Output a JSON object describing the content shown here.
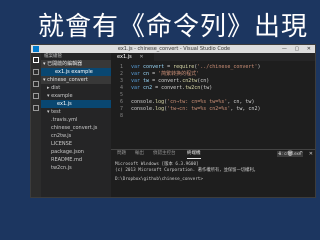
{
  "slide": {
    "title": "就會有《命令列》出現"
  },
  "window": {
    "title": "ex1.js - chinese_convert - Visual Studio Code",
    "controls": "— ▢ ✕"
  },
  "sidebar": {
    "header": "檔案總管",
    "rows": [
      {
        "label": "▾ 已開啟的編輯器",
        "indent": 2,
        "kind": "section"
      },
      {
        "label": "ex1.js example",
        "indent": 14,
        "kind": "selected"
      },
      {
        "label": "▾ chinese_convert",
        "indent": 2,
        "kind": "section"
      },
      {
        "label": "▸ dist",
        "indent": 6,
        "kind": "item"
      },
      {
        "label": "▾ example",
        "indent": 6,
        "kind": "item"
      },
      {
        "label": "ex1.js",
        "indent": 16,
        "kind": "selected"
      },
      {
        "label": "▾ test",
        "indent": 6,
        "kind": "item"
      },
      {
        "label": ".travis.yml",
        "indent": 10,
        "kind": "item"
      },
      {
        "label": "chinese_convert.js",
        "indent": 10,
        "kind": "item"
      },
      {
        "label": "cn2tw.js",
        "indent": 10,
        "kind": "item"
      },
      {
        "label": "LICENSE",
        "indent": 10,
        "kind": "item"
      },
      {
        "label": "package.json",
        "indent": 10,
        "kind": "item"
      },
      {
        "label": "README.md",
        "indent": 10,
        "kind": "item"
      },
      {
        "label": "tw2cn.js",
        "indent": 10,
        "kind": "item"
      }
    ]
  },
  "editor": {
    "tab_label": "ex1.js",
    "tab_close": "✕",
    "lines": [
      {
        "n": "1",
        "t": [
          [
            "kw",
            "var "
          ],
          [
            "var",
            "convert"
          ],
          [
            "txt",
            " = "
          ],
          [
            "fn",
            "require"
          ],
          [
            "txt",
            "("
          ],
          [
            "str",
            "'../chinese_convert'"
          ],
          [
            "txt",
            ")"
          ]
        ]
      },
      {
        "n": "2",
        "t": [
          [
            "kw",
            "var "
          ],
          [
            "var",
            "cn"
          ],
          [
            "txt",
            " = "
          ],
          [
            "str",
            "'简繁转换的程式'"
          ]
        ]
      },
      {
        "n": "3",
        "t": [
          [
            "kw",
            "var "
          ],
          [
            "var",
            "tw"
          ],
          [
            "txt",
            " = convert."
          ],
          [
            "fn",
            "cn2tw"
          ],
          [
            "txt",
            "(cn)"
          ]
        ]
      },
      {
        "n": "4",
        "t": [
          [
            "kw",
            "var "
          ],
          [
            "var",
            "cn2"
          ],
          [
            "txt",
            " = convert."
          ],
          [
            "fn",
            "tw2cn"
          ],
          [
            "txt",
            "(tw)"
          ]
        ]
      },
      {
        "n": "5",
        "t": []
      },
      {
        "n": "6",
        "t": [
          [
            "txt",
            "console."
          ],
          [
            "fn",
            "log"
          ],
          [
            "txt",
            "("
          ],
          [
            "str",
            "'cn→tw: cn=%s tw=%s'"
          ],
          [
            "txt",
            ", cn, tw)"
          ]
        ]
      },
      {
        "n": "7",
        "t": [
          [
            "txt",
            "console."
          ],
          [
            "fn",
            "log"
          ],
          [
            "txt",
            "("
          ],
          [
            "str",
            "'tw→cn: tw=%s cn2=%s'"
          ],
          [
            "txt",
            ", tw, cn2)"
          ]
        ]
      },
      {
        "n": "8",
        "t": []
      }
    ]
  },
  "panel": {
    "tabs": [
      {
        "label": "問題",
        "active": false
      },
      {
        "label": "輸出",
        "active": false
      },
      {
        "label": "偵錯主控台",
        "active": false
      },
      {
        "label": "終端機",
        "active": true
      }
    ],
    "terminal_select": "1: cmd.exe",
    "icons": "+ 🗑 ^ ✕",
    "terminal_lines": [
      "Microsoft Windows [版本 6.3.9600]",
      "(c) 2013 Microsoft Corporation. 著作權所有，並保留一切權利。",
      "",
      "D:\\Dropbox\\github\\chinese_convert>"
    ]
  }
}
